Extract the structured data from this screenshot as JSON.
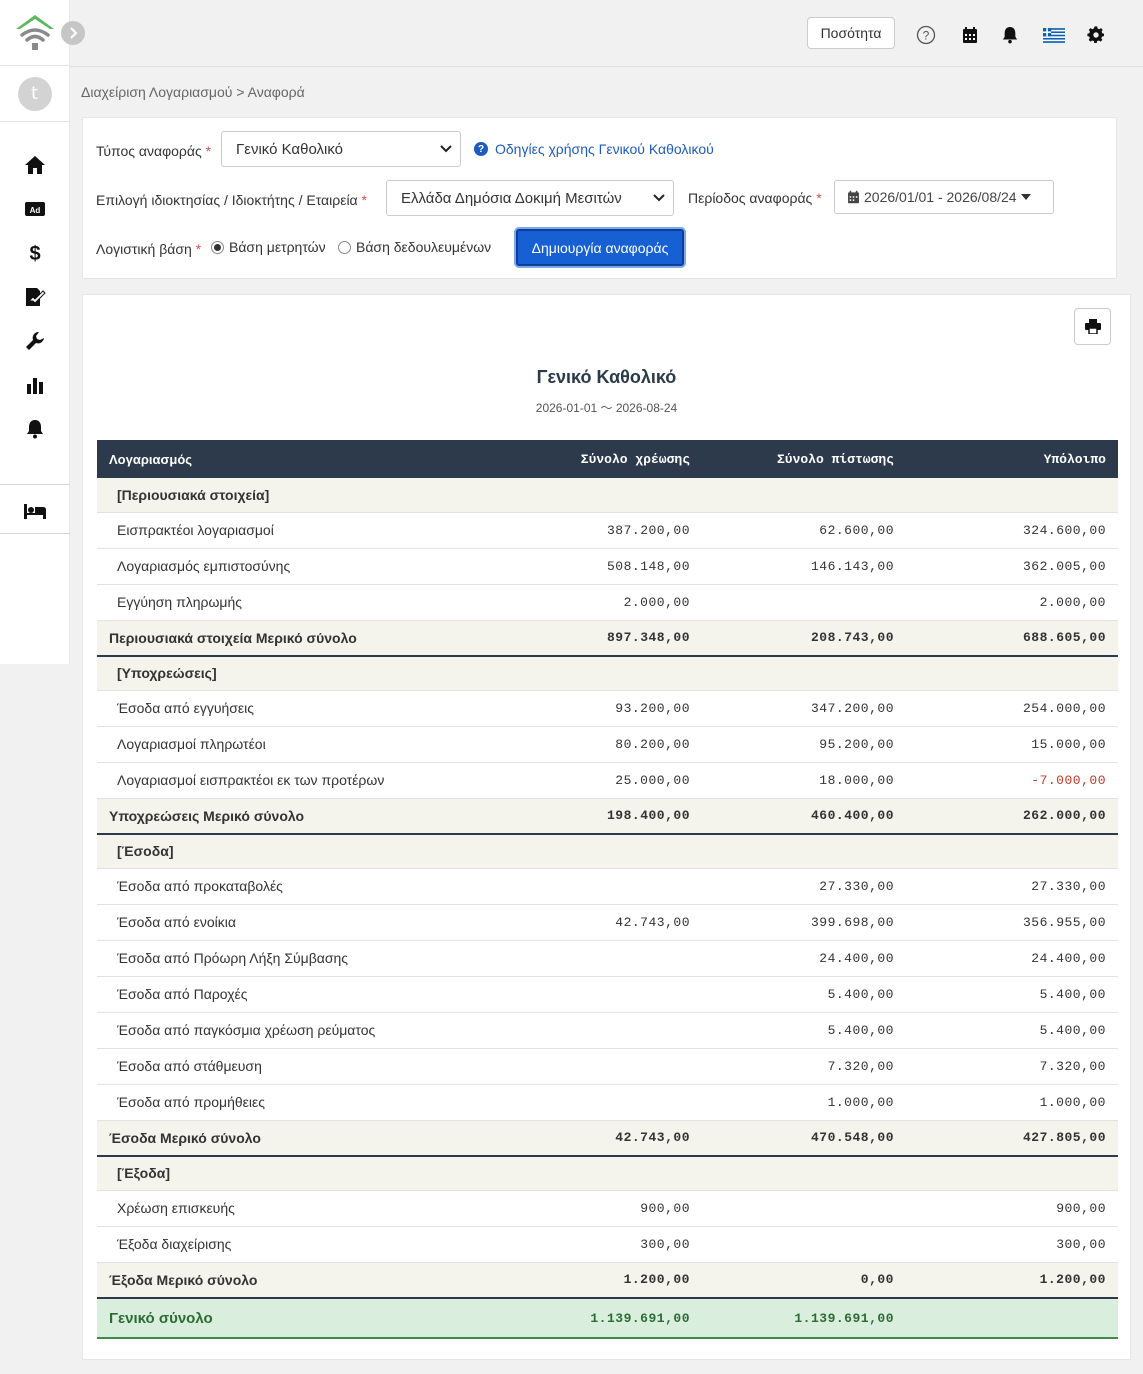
{
  "header": {
    "quantity_button": "Ποσότητα",
    "icons": [
      "help-icon",
      "calendar-icon",
      "bell-icon",
      "greek-flag-icon",
      "gear-icon"
    ]
  },
  "sidebar": {
    "avatar_letter": "t",
    "items": [
      "home-icon",
      "ad-icon",
      "dollar-icon",
      "contract-icon",
      "wrench-icon",
      "chart-icon",
      "bell-icon",
      "bed-icon"
    ]
  },
  "breadcrumb": "Διαχείριση Λογαριασμού > Αναφορά",
  "filters": {
    "report_type_label": "Τύπος αναφοράς",
    "report_type_value": "Γενικό Καθολικό",
    "help_link": "Οδηγίες χρήσης Γενικού Καθολικού",
    "property_label": "Επιλογή ιδιοκτησίας / Ιδιοκτήτης / Εταιρεία",
    "property_value": "Ελλάδα Δημόσια Δοκιμή Μεσιτών",
    "period_label": "Περίοδος αναφοράς",
    "period_value": "2026/01/01 - 2026/08/24",
    "basis_label": "Λογιστική βάση",
    "basis_cash": "Βάση μετρητών",
    "basis_accrual": "Βάση δεδουλευμένων",
    "selected_basis": "cash",
    "create_button": "Δημιουργία αναφοράς"
  },
  "report": {
    "title": "Γενικό Καθολικό",
    "period": "2026-01-01 〜 2026-08-24",
    "columns": [
      "Λογαριασμός",
      "Σύνολο χρέωσης",
      "Σύνολο πίστωσης",
      "Υπόλοιπο"
    ],
    "sections": [
      {
        "name": "[Περιουσιακά στοιχεία]",
        "rows": [
          {
            "account": "Εισπρακτέοι λογαριασμοί",
            "debit": "387.200,00",
            "credit": "62.600,00",
            "balance": "324.600,00"
          },
          {
            "account": "Λογαριασμός εμπιστοσύνης",
            "debit": "508.148,00",
            "credit": "146.143,00",
            "balance": "362.005,00"
          },
          {
            "account": "Εγγύηση πληρωμής",
            "debit": "2.000,00",
            "credit": "",
            "balance": "2.000,00"
          }
        ],
        "subtotal": {
          "label": "Περιουσιακά στοιχεία Μερικό σύνολο",
          "debit": "897.348,00",
          "credit": "208.743,00",
          "balance": "688.605,00"
        }
      },
      {
        "name": "[Υποχρεώσεις]",
        "rows": [
          {
            "account": "Έσοδα από εγγυήσεις",
            "debit": "93.200,00",
            "credit": "347.200,00",
            "balance": "254.000,00"
          },
          {
            "account": "Λογαριασμοί πληρωτέοι",
            "debit": "80.200,00",
            "credit": "95.200,00",
            "balance": "15.000,00"
          },
          {
            "account": "Λογαριασμοί εισπρακτέοι εκ των προτέρων",
            "debit": "25.000,00",
            "credit": "18.000,00",
            "balance": "-7.000,00",
            "negative": true
          }
        ],
        "subtotal": {
          "label": "Υποχρεώσεις Μερικό σύνολο",
          "debit": "198.400,00",
          "credit": "460.400,00",
          "balance": "262.000,00"
        }
      },
      {
        "name": "[Έσοδα]",
        "rows": [
          {
            "account": "Έσοδα από προκαταβολές",
            "debit": "",
            "credit": "27.330,00",
            "balance": "27.330,00"
          },
          {
            "account": "Έσοδα από ενοίκια",
            "debit": "42.743,00",
            "credit": "399.698,00",
            "balance": "356.955,00"
          },
          {
            "account": "Έσοδα από Πρόωρη Λήξη Σύμβασης",
            "debit": "",
            "credit": "24.400,00",
            "balance": "24.400,00"
          },
          {
            "account": "Έσοδα από Παροχές",
            "debit": "",
            "credit": "5.400,00",
            "balance": "5.400,00"
          },
          {
            "account": "Έσοδα από παγκόσμια χρέωση ρεύματος",
            "debit": "",
            "credit": "5.400,00",
            "balance": "5.400,00"
          },
          {
            "account": "Έσοδα από στάθμευση",
            "debit": "",
            "credit": "7.320,00",
            "balance": "7.320,00"
          },
          {
            "account": "Έσοδα από προμήθειες",
            "debit": "",
            "credit": "1.000,00",
            "balance": "1.000,00"
          }
        ],
        "subtotal": {
          "label": "Έσοδα Μερικό σύνολο",
          "debit": "42.743,00",
          "credit": "470.548,00",
          "balance": "427.805,00"
        }
      },
      {
        "name": "[Έξοδα]",
        "rows": [
          {
            "account": "Χρέωση επισκευής",
            "debit": "900,00",
            "credit": "",
            "balance": "900,00"
          },
          {
            "account": "Έξοδα διαχείρισης",
            "debit": "300,00",
            "credit": "",
            "balance": "300,00"
          }
        ],
        "subtotal": {
          "label": "Έξοδα Μερικό σύνολο",
          "debit": "1.200,00",
          "credit": "0,00",
          "balance": "1.200,00"
        }
      }
    ],
    "grand_total": {
      "label": "Γενικό σύνολο",
      "debit": "1.139.691,00",
      "credit": "1.139.691,00",
      "balance": ""
    }
  }
}
